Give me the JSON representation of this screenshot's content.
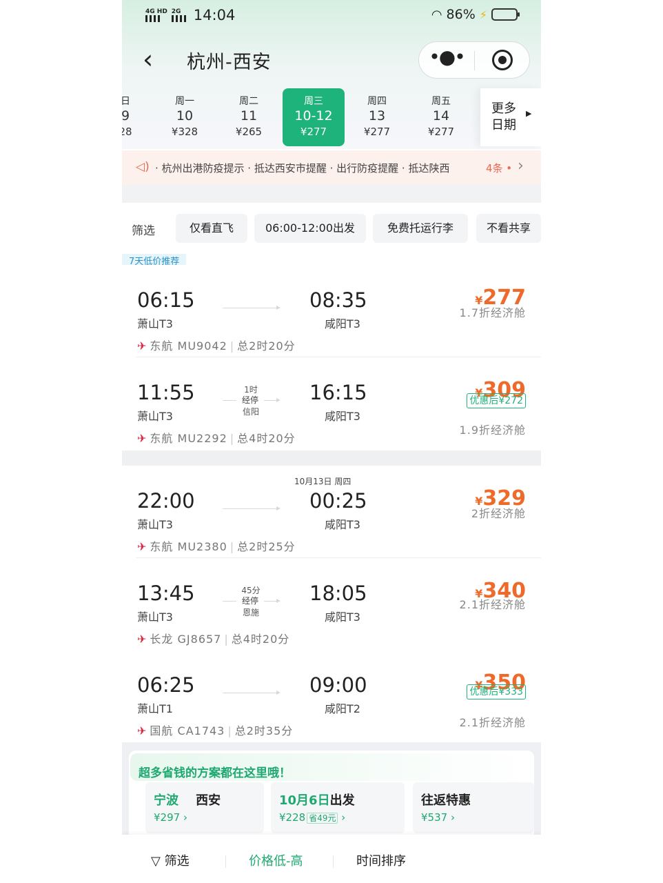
{
  "status_bar": {
    "network1": "4G HD",
    "network2": "2G",
    "time": "14:04",
    "battery": "86%",
    "battery_level": 0.86
  },
  "nav": {
    "title": "杭州-西安",
    "back_icon": "chevron-left-icon",
    "more_icon": "more-dots-icon",
    "close_icon": "target-icon"
  },
  "dates": [
    {
      "weekday": "日",
      "day": "9",
      "price": "28",
      "active": false
    },
    {
      "weekday": "周一",
      "day": "10",
      "price": "¥328",
      "active": false
    },
    {
      "weekday": "周二",
      "day": "11",
      "price": "¥265",
      "active": false
    },
    {
      "weekday": "周三",
      "day": "10-12",
      "price": "¥277",
      "active": true
    },
    {
      "weekday": "周四",
      "day": "13",
      "price": "¥277",
      "active": false
    },
    {
      "weekday": "周五",
      "day": "14",
      "price": "¥277",
      "active": false
    }
  ],
  "more_dates_label": "更多日期",
  "notice": {
    "text": "· 杭州出港防疫提示 · 抵达西安市提醒 · 出行防疫提醒 · 抵达陕西",
    "count": "4条 •"
  },
  "filters": {
    "main": "筛选",
    "chips": [
      "仅看直飞",
      "06:00-12:00出发",
      "免费托运行李",
      "不看共享"
    ]
  },
  "tag_7days": "7天低价推荐",
  "flights": [
    {
      "dep_time": "06:15",
      "dep_airport": "萧山T3",
      "arr_time": "08:35",
      "arr_airport": "咸阳T3",
      "price": "277",
      "cabin": "1.7折经济舱",
      "airline": "东航",
      "flight_no": "MU9042",
      "duration": "总2时20分"
    },
    {
      "dep_time": "11:55",
      "dep_airport": "萧山T3",
      "arr_time": "16:15",
      "arr_airport": "咸阳T3",
      "price": "309",
      "discount": "优惠后¥272",
      "cabin": "1.9折经济舱",
      "airline": "东航",
      "flight_no": "MU2292",
      "duration": "总4时20分",
      "stop_duration": "1时",
      "stop_badge": "经停",
      "stop_city": "信阳"
    },
    {
      "dep_time": "22:00",
      "dep_airport": "萧山T3",
      "arr_time": "00:25",
      "arr_airport": "咸阳T3",
      "price": "329",
      "cabin": "2折经济舱",
      "airline": "东航",
      "flight_no": "MU2380",
      "duration": "总2时25分",
      "next_day": "10月13日 周四"
    },
    {
      "dep_time": "13:45",
      "dep_airport": "萧山T3",
      "arr_time": "18:05",
      "arr_airport": "咸阳T3",
      "price": "340",
      "cabin": "2.1折经济舱",
      "airline": "长龙",
      "flight_no": "GJ8657",
      "duration": "总4时20分",
      "stop_duration": "45分",
      "stop_badge": "经停",
      "stop_city": "恩施"
    },
    {
      "dep_time": "06:25",
      "dep_airport": "萧山T1",
      "arr_time": "09:00",
      "arr_airport": "咸阳T2",
      "price": "350",
      "discount": "优惠后¥333",
      "cabin": "2.1折经济舱",
      "airline": "国航",
      "flight_no": "CA1743",
      "duration": "总2时35分"
    }
  ],
  "promo": {
    "title": "超多省钱的方案都在这里哦！",
    "items": [
      {
        "city_from": "宁波",
        "city_to": "西安",
        "price": "¥297 ›"
      },
      {
        "date": "10月6日",
        "date_suffix": "出发",
        "price": "¥228",
        "save": "省49元",
        "arrow": "›"
      },
      {
        "title": "往返特惠",
        "price": "¥537 ›"
      }
    ]
  },
  "bottom_bar": {
    "filter": "筛选",
    "price_sort": "价格低-高",
    "time_sort": "时间排序"
  },
  "colors": {
    "accent_green": "#1fb37c",
    "price_orange": "#ee6a2a",
    "notice_bg": "#fdf1ee"
  }
}
